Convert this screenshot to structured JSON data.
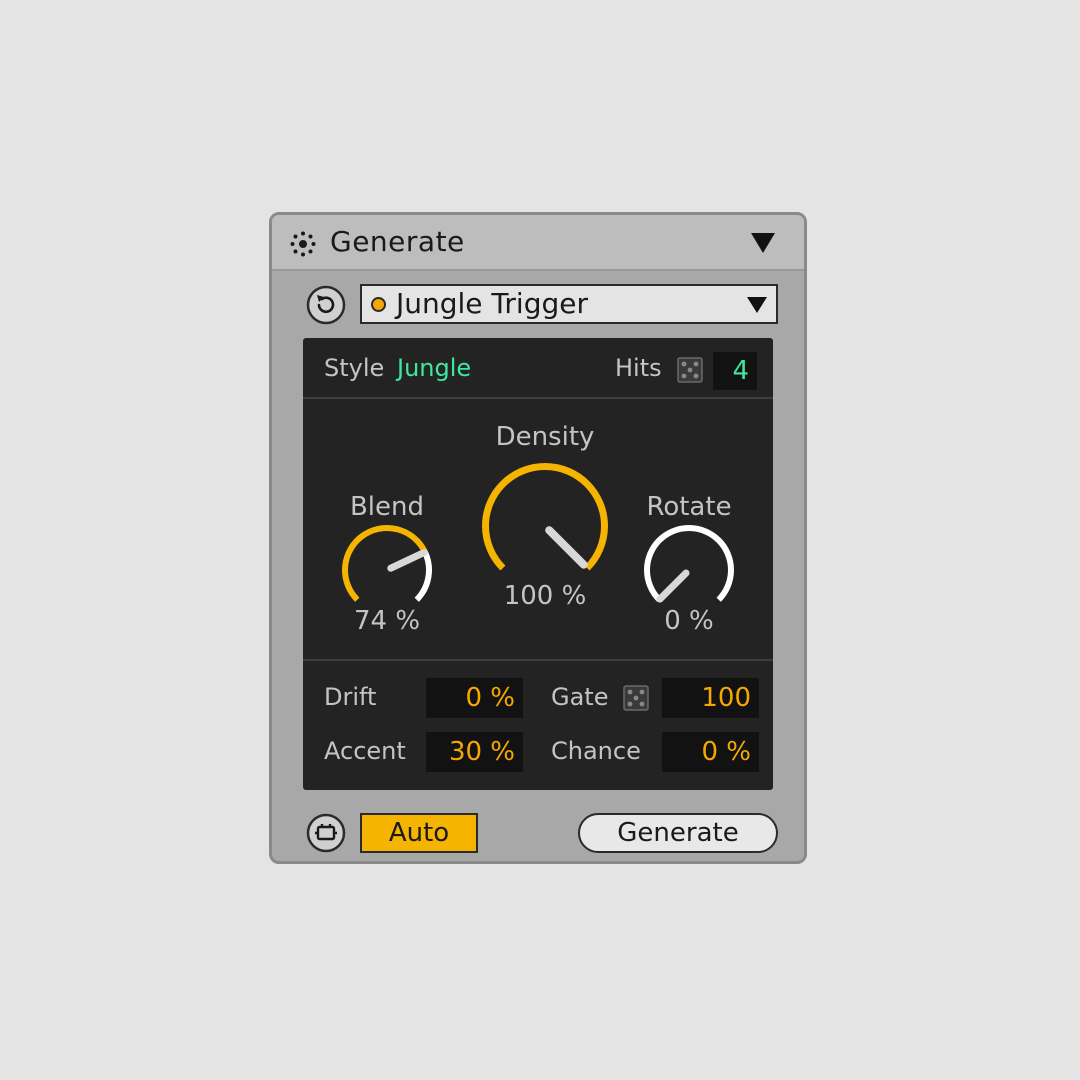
{
  "device": {
    "title": "Generate",
    "title_icon": "generate-dots-icon",
    "collapse_icon": "triangle-down-icon"
  },
  "preset": {
    "reset_icon": "reset-icon",
    "name": "Jungle Trigger",
    "dot_color": "#f5a800",
    "arrow_icon": "triangle-down-icon"
  },
  "header": {
    "style_label": "Style",
    "style_value": "Jungle",
    "hits_label": "Hits",
    "hits_value": "4",
    "accent_green": "#3ee6a0"
  },
  "knobs": {
    "blend": {
      "label": "Blend",
      "value": "74 %",
      "fraction": 0.74
    },
    "density": {
      "label": "Density",
      "value": "100 %",
      "fraction": 1.0
    },
    "rotate": {
      "label": "Rotate",
      "value": "0 %",
      "fraction": 0.0
    },
    "accent_color": "#f5b400",
    "track_color": "#ffffff"
  },
  "params": {
    "drift": {
      "label": "Drift",
      "value": "0 %"
    },
    "accent": {
      "label": "Accent",
      "value": "30 %"
    },
    "gate": {
      "label": "Gate",
      "value": "100"
    },
    "chance": {
      "label": "Chance",
      "value": "0 %"
    },
    "value_color": "#f5a800"
  },
  "footer": {
    "auto_icon": "auto-trigger-icon",
    "auto_label": "Auto",
    "generate_label": "Generate"
  }
}
